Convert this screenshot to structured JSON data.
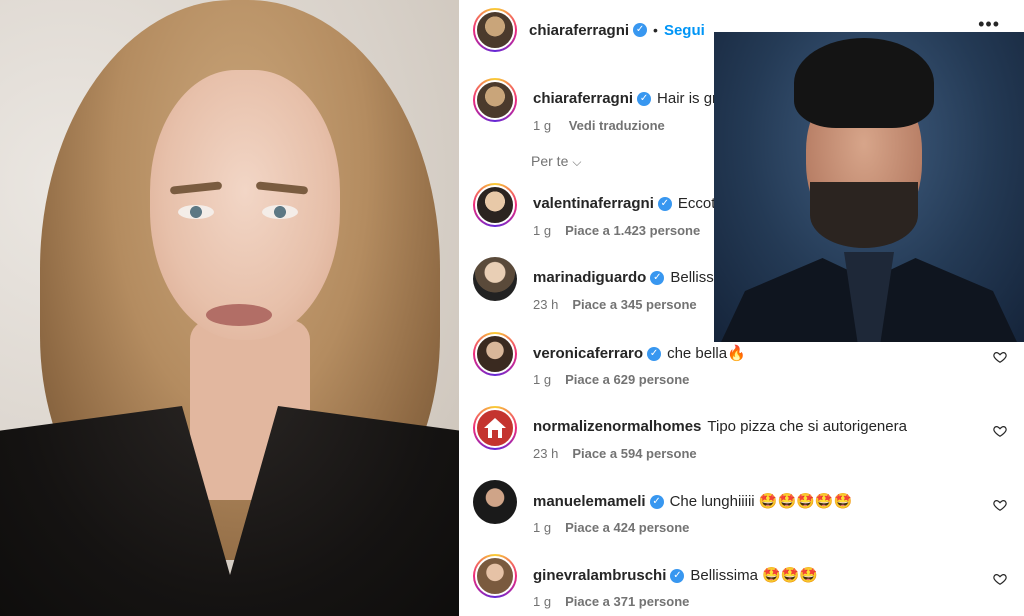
{
  "header": {
    "username": "chiaraferragni",
    "separator": "•",
    "follow_label": "Segui",
    "more": "•••"
  },
  "caption": {
    "username": "chiaraferragni",
    "text": "Hair is gr",
    "time": "1 g",
    "translate": "Vedi traduzione"
  },
  "filter": {
    "label": "Per te",
    "chevron": "⌵"
  },
  "comments": [
    {
      "username": "valentinaferragni",
      "verified": true,
      "text": "Eccot",
      "time": "1 g",
      "likes": "Piace a 1.423 persone"
    },
    {
      "username": "marinadiguardo",
      "verified": true,
      "text": "Bellissi",
      "time": "23 h",
      "likes": "Piace a 345 persone"
    },
    {
      "username": "veronicaferraro",
      "verified": true,
      "text": "che bella🔥",
      "time": "1 g",
      "likes": "Piace a 629 persone"
    },
    {
      "username": "normalizenormalhomes",
      "verified": false,
      "text": "Tipo pizza che si autorigenera",
      "time": "23 h",
      "likes": "Piace a 594 persone"
    },
    {
      "username": "manuelemameli",
      "verified": true,
      "text": "Che lunghiiiii 🤩🤩🤩🤩🤩",
      "time": "1 g",
      "likes": "Piace a 424 persone"
    },
    {
      "username": "ginevralambruschi",
      "verified": true,
      "text": "Bellissima 🤩🤩🤩",
      "time": "1 g",
      "likes": "Piace a 371 persone"
    }
  ],
  "icons": {
    "verified": "✓",
    "heart": "heart-outline-icon"
  }
}
